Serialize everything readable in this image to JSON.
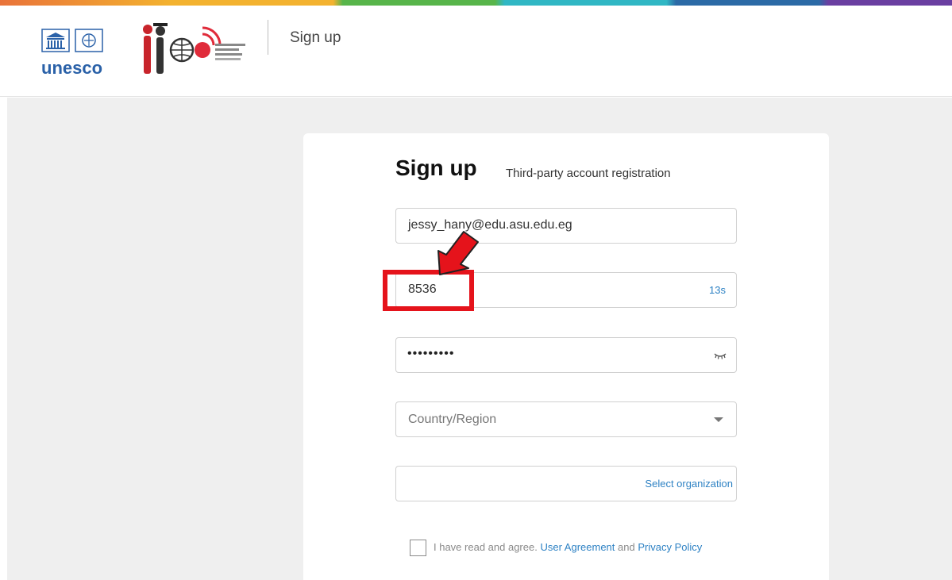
{
  "header": {
    "logo_unesco_text": "unesco",
    "title": "Sign up"
  },
  "card": {
    "title": "Sign up",
    "subtitle": "Third-party account registration"
  },
  "form": {
    "email_value": "jessy_hany@edu.asu.edu.eg",
    "code_value": "8536",
    "code_countdown": "13s",
    "password_masked": "•••••••••",
    "country_placeholder": "Country/Region",
    "organization_link": "Select organization",
    "agree_prefix": "I have read and agree.",
    "user_agreement": "User Agreement",
    "and_word": "and",
    "privacy_policy": "Privacy Policy"
  },
  "colors": {
    "link_blue": "#2e82c4",
    "highlight_red": "#e5131b",
    "background": "#efefef"
  },
  "icons": {
    "password_toggle": "eye-closed-icon",
    "country_dropdown": "caret-down-icon"
  }
}
